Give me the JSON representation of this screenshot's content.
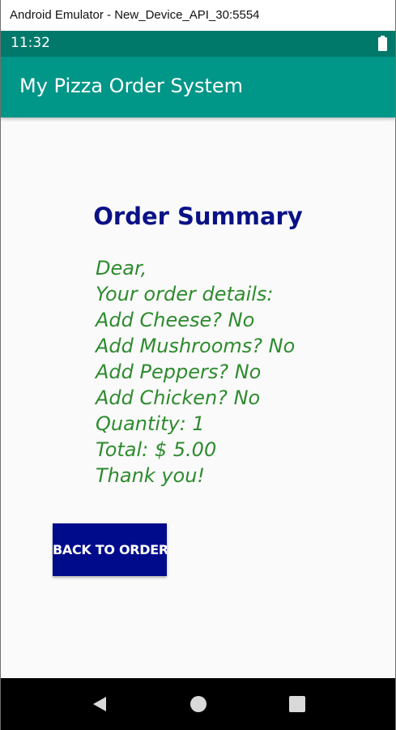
{
  "window": {
    "title": "Android Emulator - New_Device_API_30:5554"
  },
  "status_bar": {
    "time": "11:32",
    "battery_icon": "battery-full-icon"
  },
  "app": {
    "title": "My Pizza Order System"
  },
  "summary": {
    "heading": "Order Summary",
    "lines": [
      "Dear,",
      "Your order details:",
      "Add Cheese? No",
      "Add Mushrooms? No",
      "Add Peppers? No",
      "Add Chicken? No",
      "Quantity: 1",
      "Total: $ 5.00",
      "Thank you!"
    ]
  },
  "actions": {
    "back_label": "BACK TO ORDER"
  },
  "nav": {
    "back_icon": "back-triangle-icon",
    "home_icon": "home-circle-icon",
    "recents_icon": "recents-square-icon"
  },
  "colors": {
    "status_bar": "#00796b",
    "action_bar": "#009688",
    "heading": "#0a1286",
    "body_text": "#2e8b2e",
    "button": "#000b8c",
    "content_bg": "#fafafa"
  }
}
